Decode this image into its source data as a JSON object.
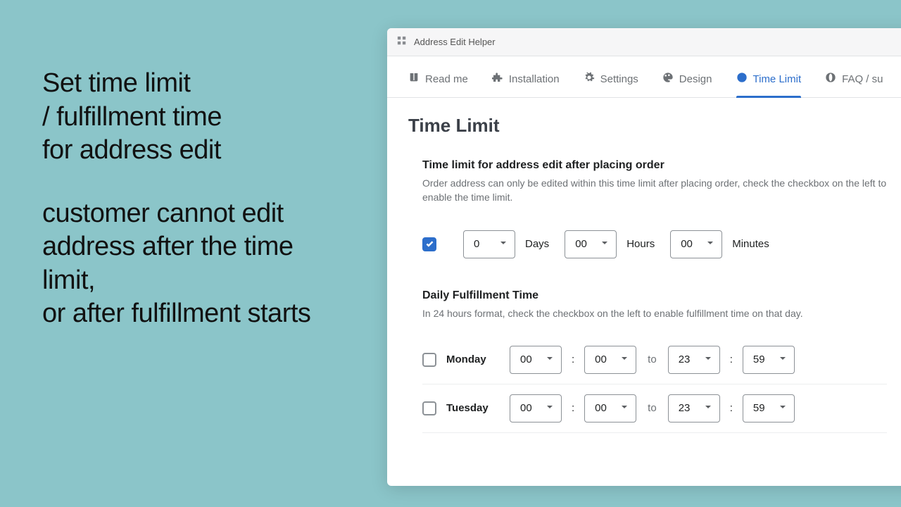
{
  "promo": {
    "block1": "Set time limit\n/ fulfillment time\nfor address edit",
    "block2": "customer cannot edit address after the time limit,\nor after fulfillment starts"
  },
  "window": {
    "title": "Address Edit Helper"
  },
  "tabs": [
    {
      "label": "Read me"
    },
    {
      "label": "Installation"
    },
    {
      "label": "Settings"
    },
    {
      "label": "Design"
    },
    {
      "label": "Time Limit"
    },
    {
      "label": "FAQ / su"
    }
  ],
  "page": {
    "title": "Time Limit"
  },
  "timelimit": {
    "title": "Time limit for address edit after placing order",
    "help": "Order address can only be edited within this time limit after placing order, check the checkbox on the left to enable the time limit.",
    "days": "0",
    "days_label": "Days",
    "hours": "00",
    "hours_label": "Hours",
    "minutes": "00",
    "minutes_label": "Minutes"
  },
  "fulfillment": {
    "title": "Daily Fulfillment Time",
    "help": "In 24 hours format, check the checkbox on the left to enable fulfillment time on that day.",
    "to": "to",
    "days": [
      {
        "name": "Monday",
        "start_h": "00",
        "start_m": "00",
        "end_h": "23",
        "end_m": "59"
      },
      {
        "name": "Tuesday",
        "start_h": "00",
        "start_m": "00",
        "end_h": "23",
        "end_m": "59"
      }
    ]
  }
}
